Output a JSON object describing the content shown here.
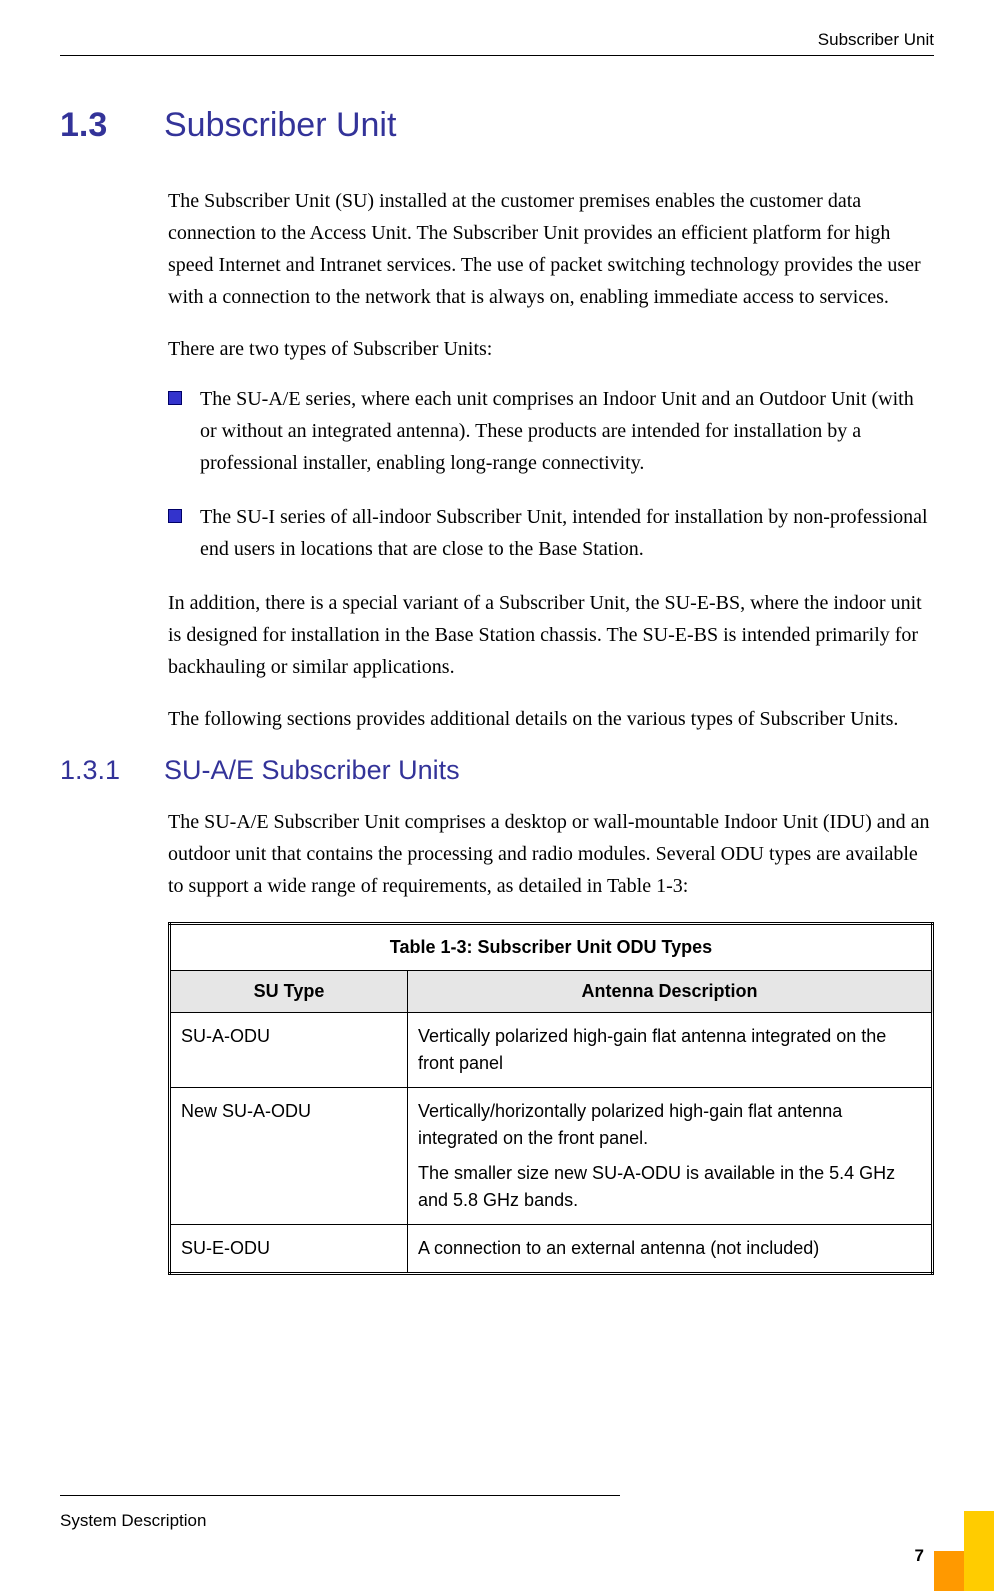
{
  "header": {
    "right": "Subscriber Unit"
  },
  "section": {
    "number": "1.3",
    "title": "Subscriber Unit"
  },
  "para1": "The Subscriber Unit (SU) installed at the customer premises enables the customer data connection to the Access Unit. The Subscriber Unit provides an efficient platform for high speed Internet and Intranet services. The use of packet switching technology provides the user with a connection to the network that is always on, enabling immediate access to services.",
  "para2": "There are two types of Subscriber Units:",
  "bullets": [
    "The SU-A/E series, where each unit comprises an Indoor Unit and an Outdoor Unit (with or without an integrated antenna). These products are intended for installation by a professional installer, enabling long-range connectivity.",
    "The SU-I series of all-indoor Subscriber Unit, intended for installation by non-professional end users in locations that are close to the Base Station."
  ],
  "para3": "In addition, there is a special variant of a Subscriber Unit, the SU-E-BS, where the indoor unit is designed for installation in the Base Station chassis. The SU-E-BS is intended primarily for backhauling or similar applications.",
  "para4": "The following sections provides additional details on the various types of Subscriber Units.",
  "subsection": {
    "number": "1.3.1",
    "title": "SU-A/E Subscriber Units"
  },
  "para5": "The SU-A/E Subscriber Unit comprises a desktop or wall-mountable Indoor Unit (IDU) and an outdoor unit that contains the processing and radio modules. Several ODU types are available to support a wide range of requirements, as detailed in Table 1-3:",
  "table": {
    "caption": "Table 1-3: Subscriber Unit ODU Types",
    "headers": [
      "SU Type",
      "Antenna Description"
    ],
    "rows": [
      {
        "type": "SU-A-ODU",
        "desc1": "Vertically polarized high-gain flat antenna integrated on the front panel",
        "desc2": ""
      },
      {
        "type": "New SU-A-ODU",
        "desc1": "Vertically/horizontally polarized high-gain flat antenna integrated on the front panel.",
        "desc2": "The smaller size new SU-A-ODU is available in the 5.4 GHz and 5.8 GHz bands."
      },
      {
        "type": "SU-E-ODU",
        "desc1": "A connection to an external antenna (not included)",
        "desc2": ""
      }
    ]
  },
  "footer": {
    "left": "System Description",
    "page": "7"
  }
}
